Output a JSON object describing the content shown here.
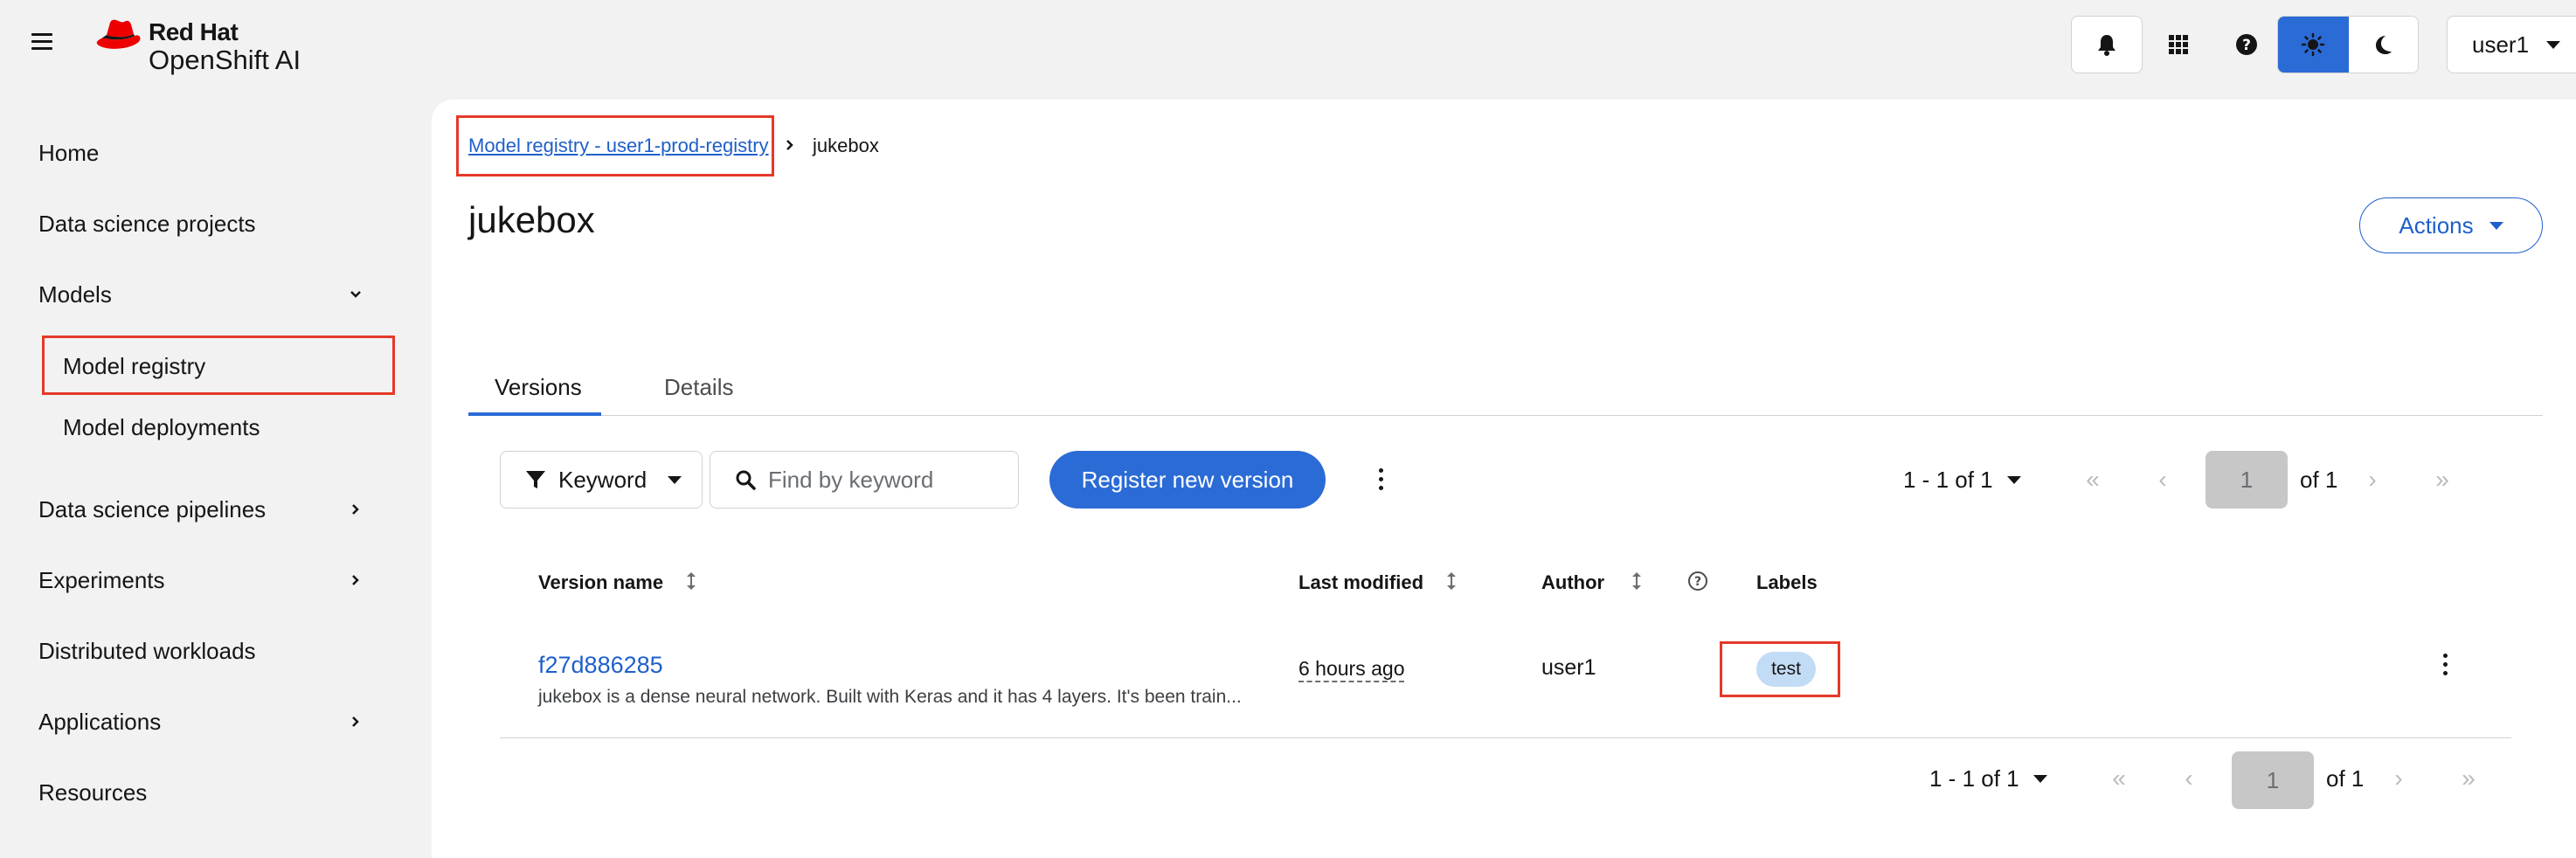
{
  "brand": {
    "name": "Red Hat",
    "product": "OpenShift AI",
    "logo_color": "#ee0000"
  },
  "masthead": {
    "user": "user1",
    "icons": [
      "bell-icon",
      "app-grid-icon",
      "help-icon",
      "sun-icon",
      "moon-icon"
    ],
    "theme_active": "light"
  },
  "sidebar": {
    "items": [
      {
        "label": "Home"
      },
      {
        "label": "Data science projects"
      },
      {
        "label": "Models",
        "expanded": true
      },
      {
        "label": "Model registry",
        "active": true
      },
      {
        "label": "Model deployments"
      },
      {
        "label": "Data science pipelines"
      },
      {
        "label": "Experiments"
      },
      {
        "label": "Distributed workloads"
      },
      {
        "label": "Applications"
      },
      {
        "label": "Resources"
      }
    ]
  },
  "breadcrumb": {
    "link": "Model registry - user1-prod-registry",
    "current": "jukebox"
  },
  "page": {
    "title": "jukebox",
    "actions_label": "Actions"
  },
  "tabs": [
    {
      "label": "Versions",
      "active": true
    },
    {
      "label": "Details"
    }
  ],
  "toolbar": {
    "filter_label": "Keyword",
    "search_placeholder": "Find by keyword",
    "register_label": "Register new version"
  },
  "pagination": {
    "range": "1 - 1 of 1",
    "page": "1",
    "of": "of 1"
  },
  "table": {
    "columns": [
      "Version name",
      "Last modified",
      "Author",
      "Labels"
    ],
    "rows": [
      {
        "name": "f27d886285",
        "description": "jukebox is a dense neural network. Built with Keras and it has 4 layers. It's been train...",
        "last_modified": "6 hours ago",
        "author": "user1",
        "label": "test"
      }
    ]
  },
  "colors": {
    "accent": "#2b6bd6",
    "link": "#1f5fcc",
    "highlight": "#e4392a",
    "label_chip": "#c3dcf5"
  }
}
